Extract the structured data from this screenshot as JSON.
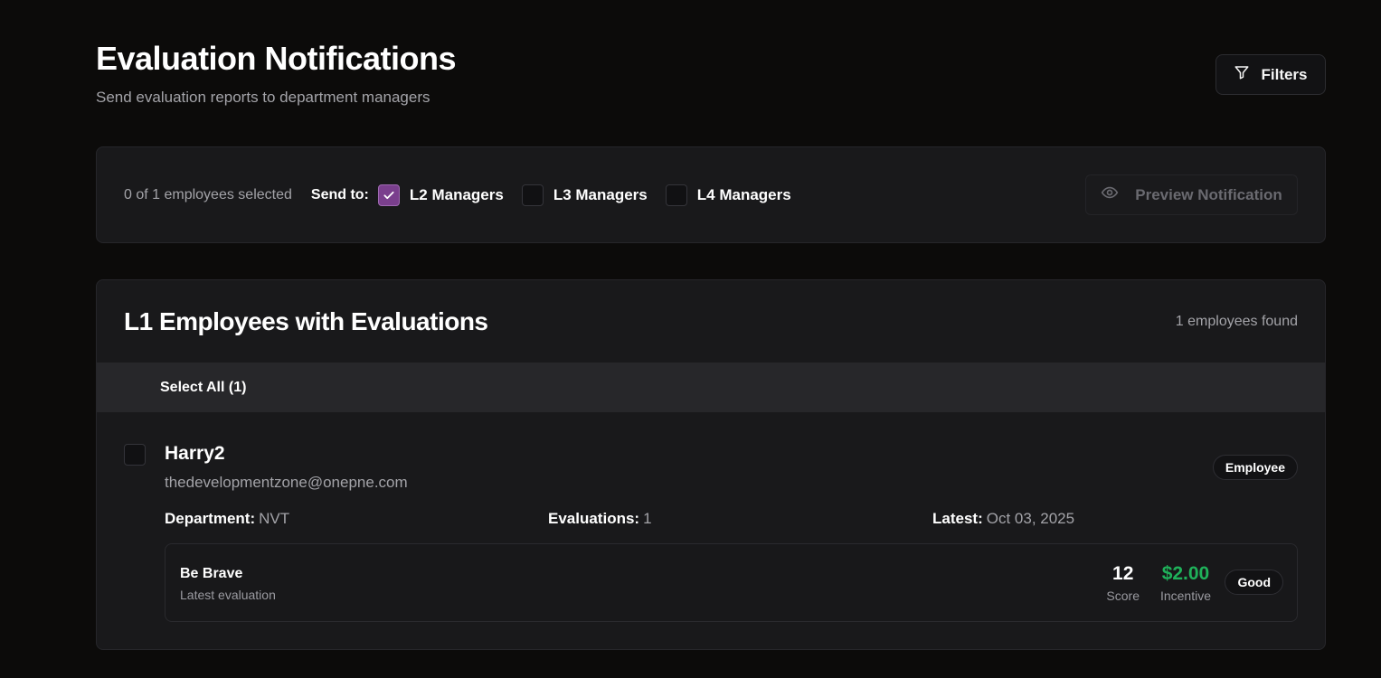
{
  "header": {
    "title": "Evaluation Notifications",
    "subtitle": "Send evaluation reports to department managers",
    "filters_label": "Filters"
  },
  "controls": {
    "selected_text": "0 of 1 employees selected",
    "send_to_label": "Send to:",
    "managers": [
      {
        "label": "L2 Managers",
        "checked": true
      },
      {
        "label": "L3 Managers",
        "checked": false
      },
      {
        "label": "L4 Managers",
        "checked": false
      }
    ],
    "preview_label": "Preview Notification"
  },
  "employees": {
    "title": "L1 Employees with Evaluations",
    "found_text": "1 employees found",
    "select_all_label": "Select All (1)",
    "rows": [
      {
        "name": "Harry2",
        "email": "thedevelopmentzone@onepne.com",
        "role": "Employee",
        "department_label": "Department:",
        "department": "NVT",
        "evaluations_label": "Evaluations:",
        "evaluations": "1",
        "latest_label": "Latest:",
        "latest": "Oct 03, 2025",
        "evaluation": {
          "name": "Be Brave",
          "sub": "Latest evaluation",
          "score": "12",
          "score_label": "Score",
          "incentive": "$2.00",
          "incentive_label": "Incentive",
          "rating": "Good"
        }
      }
    ]
  },
  "colors": {
    "accent_purple": "#7a3f8d",
    "incentive_green": "#1fb15a",
    "background": "#0c0b0a",
    "card": "#19191b"
  }
}
